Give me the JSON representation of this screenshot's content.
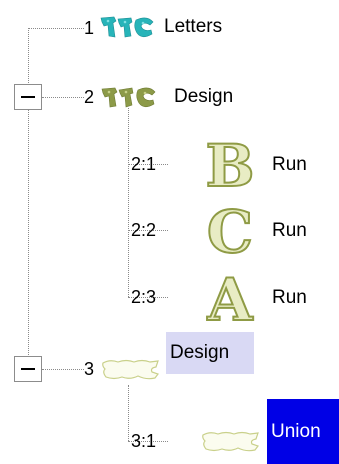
{
  "tree": {
    "items": [
      {
        "id": "1",
        "label": "Letters",
        "icon": "letters-filled-cyan-icon"
      },
      {
        "id": "2",
        "label": "Design",
        "icon": "design-filled-olive-icon",
        "toggle": "collapse"
      },
      {
        "id": "2:1",
        "label": "Run",
        "icon": "gothic-B-outline-icon",
        "glyph": "B"
      },
      {
        "id": "2:2",
        "label": "Run",
        "icon": "gothic-C-outline-icon",
        "glyph": "C"
      },
      {
        "id": "2:3",
        "label": "Run",
        "icon": "gothic-A-outline-icon",
        "glyph": "A"
      },
      {
        "id": "3",
        "label": "Design",
        "icon": "design-outline-light-icon",
        "toggle": "collapse",
        "state": "hover"
      },
      {
        "id": "3:1",
        "label": "Union",
        "icon": "union-outline-light-icon",
        "state": "selected"
      }
    ]
  },
  "colors": {
    "cyan": "#27b4b9",
    "olive": "#8c9a48",
    "gothic_fill": "#e8ecc4",
    "gothic_stroke": "#8f9b45",
    "light_outline": "#c9d08a",
    "hover_bg": "#d9d9f4",
    "selected_bg": "#0000e6"
  }
}
